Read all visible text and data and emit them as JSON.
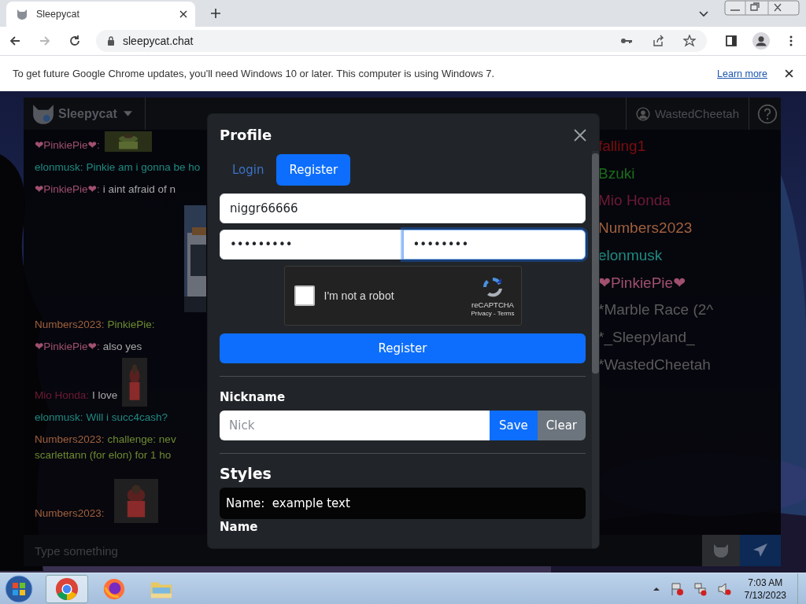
{
  "browser": {
    "tab": {
      "title": "Sleepycat"
    },
    "address": "sleepycat.chat",
    "forward_disabled": true,
    "infobar": {
      "message": "To get future Google Chrome updates, you'll need Windows 10 or later. This computer is using Windows 7.",
      "link": "Learn more"
    }
  },
  "app": {
    "brand": "Sleepycat",
    "user": "WastedCheetah",
    "messages": [
      {
        "kind": "message",
        "lines": [
          [
            {
              "text": "❤PinkiePie❤:",
              "color": "#a0506e"
            }
          ]
        ],
        "picture": true
      },
      {
        "kind": "message",
        "lines": [
          [
            {
              "text": "elonmusk:",
              "color": "#1f8a80"
            },
            {
              "text": "Pinkie am i gonna be ho",
              "color": "#1f8a80"
            }
          ]
        ],
        "picture": false
      },
      {
        "kind": "message",
        "lines": [
          [
            {
              "text": "❤PinkiePie❤:",
              "color": "#a0506e"
            },
            {
              "text": "i aint afraid of n",
              "color": "#a8a8a8"
            }
          ]
        ],
        "picture": false
      },
      {
        "kind": "picture"
      },
      {
        "kind": "message",
        "lines": [
          [
            {
              "text": "Numbers2023:",
              "color": "#a0603c"
            },
            {
              "text": "PinkiePie:",
              "color": "#6e8a30"
            }
          ]
        ],
        "picture": false
      },
      {
        "kind": "message",
        "lines": [
          [
            {
              "text": "❤PinkiePie❤:",
              "color": "#a0506e"
            },
            {
              "text": "also yes",
              "color": "#a8a8a8"
            }
          ]
        ],
        "picture": false
      },
      {
        "kind": "message",
        "lines": [
          [
            {
              "text": "Mio Honda:",
              "color": "#6e1a34"
            },
            {
              "text": "I love",
              "color": "#a8a8a8"
            }
          ]
        ],
        "picture": true
      },
      {
        "kind": "message",
        "lines": [
          [
            {
              "text": "elonmusk:",
              "color": "#1f8a80"
            },
            {
              "text": "Will i succ4cash?",
              "color": "#1f8a80"
            }
          ]
        ],
        "picture": false
      },
      {
        "kind": "message",
        "lines": [
          [
            {
              "text": "Numbers2023:",
              "color": "#a0603c"
            },
            {
              "text": "challenge: nev",
              "color": "#6e8a30"
            }
          ],
          [
            {
              "text": "scarlettann (for elon) for 1 ho",
              "color": "#6e8a30"
            }
          ]
        ],
        "picture": false
      },
      {
        "kind": "message",
        "lines": [
          [
            {
              "text": "Numbers2023:",
              "color": "#a0603c"
            }
          ]
        ],
        "picture": true
      }
    ],
    "users": [
      {
        "name": "falling1",
        "color": "#7a0e0e"
      },
      {
        "name": "Bzuki",
        "color": "#1a6e1a"
      },
      {
        "name": "Mio Honda",
        "color": "#6e1a34"
      },
      {
        "name": "Numbers2023",
        "color": "#a0603c"
      },
      {
        "name": "elonmusk",
        "color": "#1f8a80"
      },
      {
        "name": "❤PinkiePie❤",
        "color": "#a0506e"
      },
      {
        "name": "*Marble Race (2^",
        "color": "#5a5a5a"
      },
      {
        "name": "*_Sleepyland_",
        "color": "#5a5a5a"
      },
      {
        "name": "*WastedCheetah",
        "color": "#5a5a5a"
      }
    ],
    "input": {
      "placeholder": "Type something"
    }
  },
  "modal": {
    "title": "Profile",
    "tabs": [
      {
        "label": "Login",
        "selected": false
      },
      {
        "label": "Register",
        "selected": true
      }
    ],
    "username": {
      "value": "niggr66666",
      "focused": false
    },
    "passwords": [
      {
        "value": "•••••••••",
        "focused": false
      },
      {
        "value": "••••••••",
        "focused": true
      }
    ],
    "captcha": {
      "label": "I'm not a robot",
      "checked": false,
      "brand": "reCAPTCHA",
      "links": "Privacy - Terms"
    },
    "register_button": "Register",
    "nickname": {
      "label": "Nickname",
      "placeholder": "Nick",
      "save": "Save",
      "clear": "Clear"
    },
    "styles": {
      "title": "Styles",
      "preview": "Name:  example text",
      "field_label": "Name"
    }
  },
  "taskbar": {
    "time": "7:03 AM",
    "date": "7/13/2023"
  }
}
